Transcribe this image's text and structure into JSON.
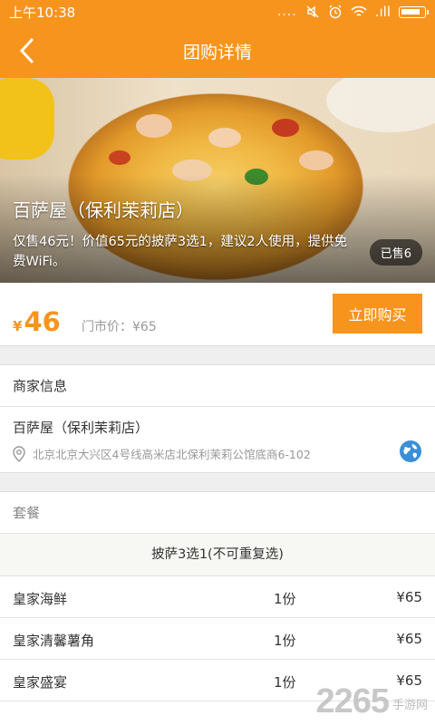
{
  "status_bar": {
    "time": "上午10:38",
    "signal": "....",
    "network": ".ıll"
  },
  "title_bar": {
    "title": "团购详情"
  },
  "hero": {
    "shop_name": "百萨屋（保利茉莉店）",
    "description": "仅售46元！价值65元的披萨3选1，建议2人使用，提供免费WiFi。",
    "sold": "已售6"
  },
  "price": {
    "currency": "¥",
    "amount": "46",
    "market_label": "门市价：¥65",
    "buy_label": "立即购买"
  },
  "merchant": {
    "header": "商家信息",
    "name": "百萨屋（保利茉莉店）",
    "address": "北京北京大兴区4号线高米店北保利茉莉公馆底商6-102"
  },
  "package": {
    "header": "套餐",
    "subtitle": "披萨3选1(不可重复选)",
    "items": [
      {
        "name": "皇家海鲜",
        "qty": "1份",
        "price": "¥65"
      },
      {
        "name": "皇家清馨薯角",
        "qty": "1份",
        "price": "¥65"
      },
      {
        "name": "皇家盛宴",
        "qty": "1份",
        "price": "¥65"
      }
    ]
  },
  "watermark": {
    "main": "2265",
    "sub": "手游网"
  },
  "colors": {
    "accent": "#f7941d"
  }
}
